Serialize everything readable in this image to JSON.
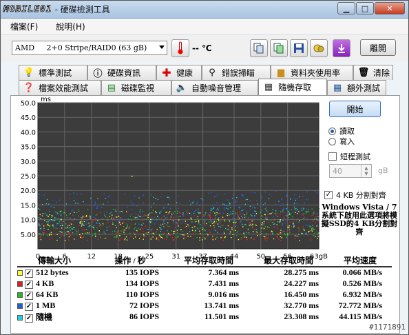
{
  "window": {
    "brand_logo": "MOBILE01",
    "title": "- 硬碟檢測工具"
  },
  "menu": [
    {
      "label": "檔案(F)"
    },
    {
      "label": "說明(H)"
    }
  ],
  "toolbar": {
    "drive_select": "AMD     2+0 Stripe/RAID0 (63 gB)",
    "temperature": "-- ℃",
    "exit_label": "離開"
  },
  "tabs_top": [
    "標準測試",
    "硬碟資訊",
    "健康",
    "錯誤掃瞄",
    "資料夾使用率",
    "清除"
  ],
  "tabs_bottom": [
    "檔案效能測試",
    "磁碟監視",
    "自動噪音管理",
    "隨機存取",
    "額外測試"
  ],
  "active_tab": "隨機存取",
  "controls": {
    "start_label": "開始",
    "read_label": "讀取",
    "write_label": "寫入",
    "short_test_label": "短程測試",
    "size_value": "40",
    "size_unit": "gB",
    "align_label": "4 KB 分割對齊",
    "note": "Windows Vista / 7系統下啟用此選項將模擬SSD的4 KB分割對齊"
  },
  "chart_data": {
    "type": "scatter",
    "ylabel": "ms",
    "ylim": [
      0,
      50
    ],
    "yticks": [
      "50.0",
      "45.0",
      "40.0",
      "35.0",
      "30.0",
      "25.0",
      "20.0",
      "15.0",
      "10.0",
      "5.00"
    ],
    "xlim": [
      0,
      63
    ],
    "xticks": [
      "0",
      "6",
      "12",
      "18",
      "25",
      "31",
      "37",
      "44",
      "50",
      "56",
      "63gB"
    ],
    "grid": true,
    "series": [
      {
        "name": "512 bytes",
        "color": "#ffff30",
        "band": [
          3.0,
          13.0
        ]
      },
      {
        "name": "4 KB",
        "color": "#ff2020",
        "band": [
          3.0,
          13.0
        ]
      },
      {
        "name": "64 KB",
        "color": "#20c020",
        "band": [
          4.0,
          14.0
        ]
      },
      {
        "name": "1 MB",
        "color": "#2060ff",
        "band": [
          8.0,
          20.0
        ]
      },
      {
        "name": "隨機",
        "color": "#20d0e0",
        "band": [
          5.0,
          18.0
        ]
      }
    ]
  },
  "results": {
    "headers": [
      "傳輸大小",
      "操作 / 秒",
      "平均存取時間",
      "最大存取時間",
      "平均速度"
    ],
    "rows": [
      {
        "size": "512 bytes",
        "color": "#ffff30",
        "ops": "135 IOPS",
        "avg": "7.364 ms",
        "max": "28.275 ms",
        "speed": "0.066 MB/s"
      },
      {
        "size": "4 KB",
        "color": "#e02020",
        "ops": "134 IOPS",
        "avg": "7.431 ms",
        "max": "24.227 ms",
        "speed": "0.526 MB/s"
      },
      {
        "size": "64 KB",
        "color": "#20c020",
        "ops": "110 IOPS",
        "avg": "9.016 ms",
        "max": "16.450 ms",
        "speed": "6.932 MB/s"
      },
      {
        "size": "1 MB",
        "color": "#2060e0",
        "ops": "72 IOPS",
        "avg": "13.741 ms",
        "max": "32.770 ms",
        "speed": "72.772 MB/s"
      },
      {
        "size": "隨機",
        "color": "#20d0e0",
        "ops": "86 IOPS",
        "avg": "11.501 ms",
        "max": "23.308 ms",
        "speed": "44.115 MB/s"
      }
    ]
  },
  "watermark": "#1171891"
}
